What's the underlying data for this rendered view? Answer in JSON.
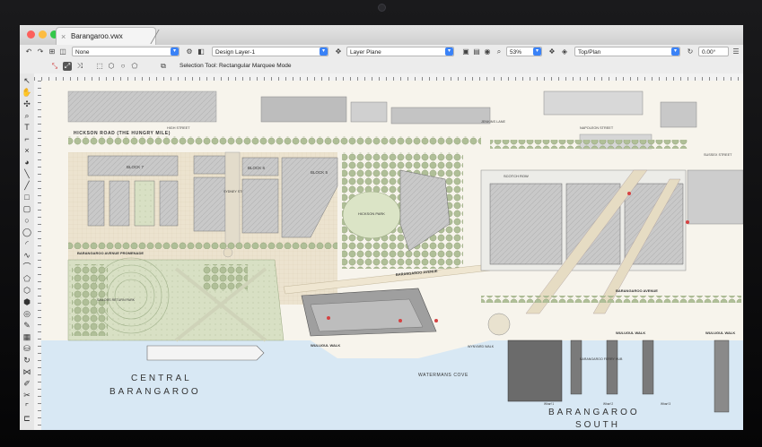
{
  "window": {
    "tab_title": "Barangaroo.vwx",
    "tab_close": "×"
  },
  "toolbar": {
    "class_value": "None",
    "layer_value": "Design Layer-1",
    "plane_value": "Layer Plane",
    "zoom_value": "53%",
    "view_value": "Top/Plan",
    "rotation_value": "0.00°"
  },
  "mode_bar": {
    "mode_text": "Selection Tool: Rectangular Marquee Mode"
  },
  "map": {
    "streets": {
      "high_street": "HIGH STREET",
      "jenkins_lane": "JENKINS LANE",
      "napoleon_street": "NAPOLEON STREET",
      "sussex_street": "SUSSEX STREET",
      "hickson_road": "HICKSON ROAD (THE HUNGRY MILE)",
      "scotch_row": "SCOTCH ROW",
      "barangaroo_avenue_promenade": "BARANGAROO AVENUE PROMENADE",
      "barangaroo_avenue": "BARANGAROO AVENUE",
      "barangaroo_avenue_south": "BARANGAROO AVENUE",
      "wulugul_walk_central": "WULUGUL WALK",
      "wulugul_walk_south": "WULUGUL WALK",
      "wulugul_walk_east": "WULUGUL WALK"
    },
    "blocks": {
      "block7": "BLOCK 7",
      "block6": "BLOCK 6",
      "block5": "BLOCK 5",
      "sydney_steps": "SYDNEY STEPS"
    },
    "places": {
      "hickson_park": "HICKSON PARK",
      "sailors_return_park": "SAILORS RETURN PARK",
      "watermans_cove": "WATERMANS COVE",
      "wynyard_walk": "WYNYARD WALK",
      "ferry_hub": "BARANGAROO FERRY HUB",
      "wharf1": "Wharf 1",
      "wharf2": "Wharf 2",
      "wharf3": "Wharf 3",
      "central_1": "CENTRAL",
      "central_2": "BARANGAROO",
      "south_1": "BARANGAROO",
      "south_2": "SOUTH"
    }
  },
  "colors": {
    "water": "#d8e8f4",
    "park": "#d3dcc0",
    "tree": "#a9b98f",
    "building": "#cfcfcf",
    "accent": "#3a82f7"
  }
}
